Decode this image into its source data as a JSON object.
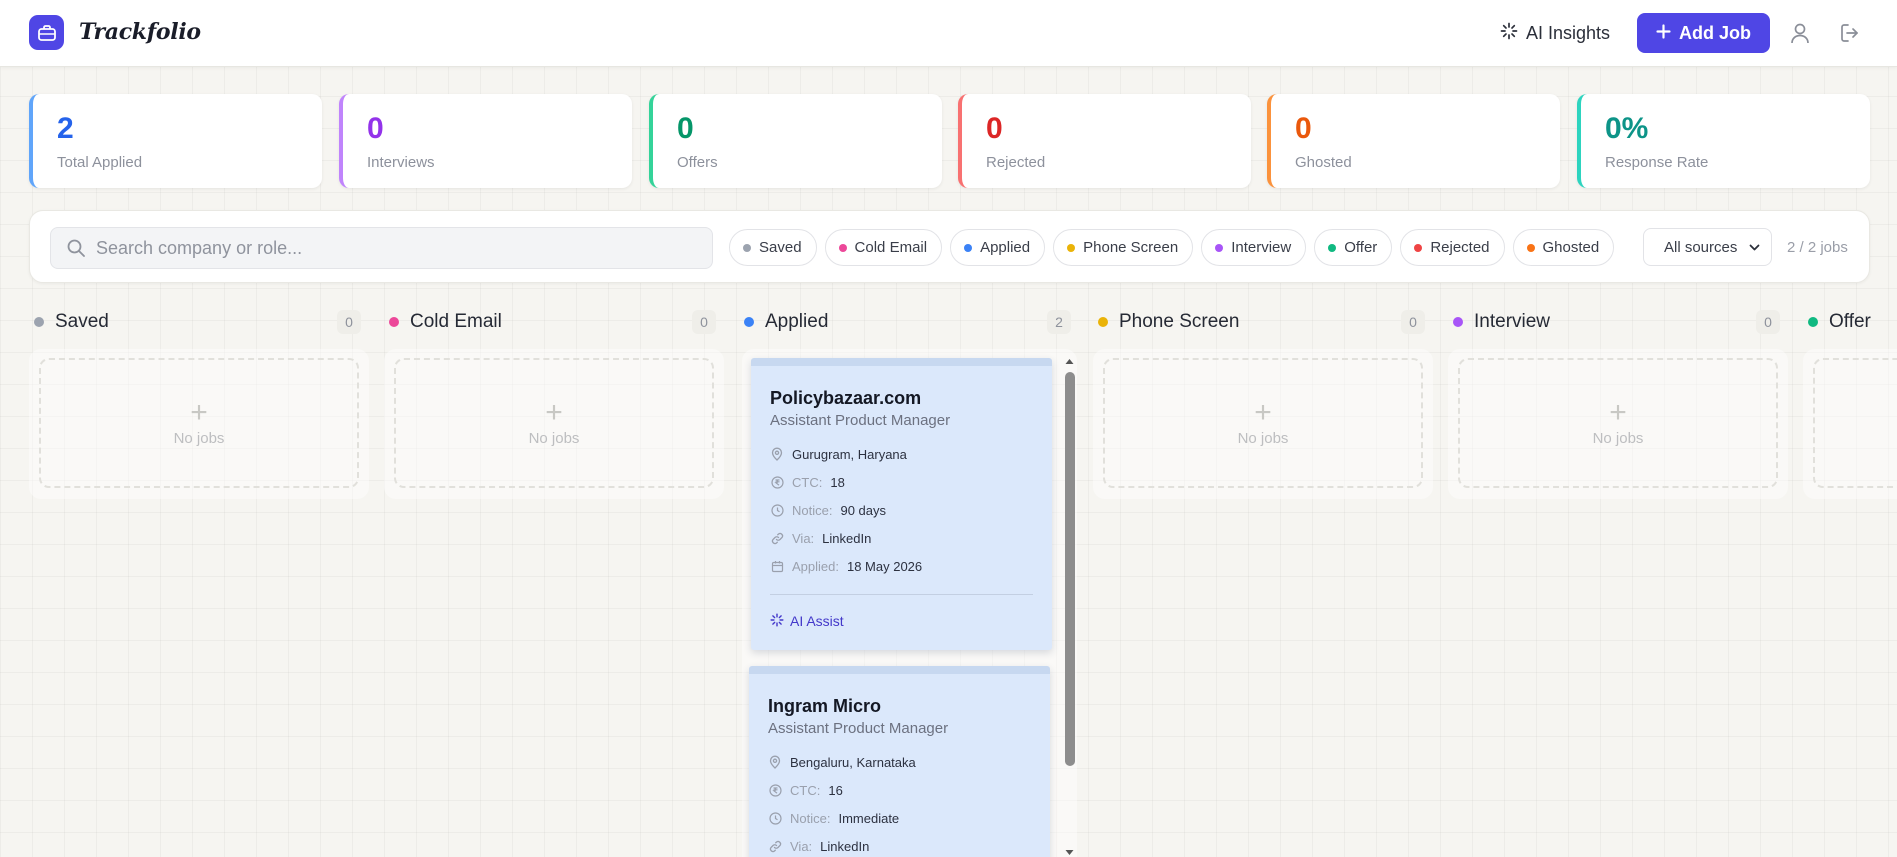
{
  "app": {
    "brand": "Trackfolio",
    "ai_insights_label": "AI Insights",
    "add_job_label": "Add Job",
    "accent": "#4f46e5"
  },
  "stats": [
    {
      "value": "2",
      "label": "Total Applied",
      "color": "#2563eb",
      "border": "#60a5fa"
    },
    {
      "value": "0",
      "label": "Interviews",
      "color": "#9333ea",
      "border": "#c084fc"
    },
    {
      "value": "0",
      "label": "Offers",
      "color": "#059669",
      "border": "#34d399"
    },
    {
      "value": "0",
      "label": "Rejected",
      "color": "#dc2626",
      "border": "#f87171"
    },
    {
      "value": "0",
      "label": "Ghosted",
      "color": "#ea580c",
      "border": "#fb923c"
    },
    {
      "value": "0%",
      "label": "Response Rate",
      "color": "#0d9488",
      "border": "#2dd4bf"
    }
  ],
  "filters": {
    "search_placeholder": "Search company or role...",
    "chips": [
      {
        "label": "Saved",
        "color": "#9ca3af"
      },
      {
        "label": "Cold Email",
        "color": "#ec4899"
      },
      {
        "label": "Applied",
        "color": "#3b82f6"
      },
      {
        "label": "Phone Screen",
        "color": "#eab308"
      },
      {
        "label": "Interview",
        "color": "#a855f7"
      },
      {
        "label": "Offer",
        "color": "#10b981"
      },
      {
        "label": "Rejected",
        "color": "#ef4444"
      },
      {
        "label": "Ghosted",
        "color": "#f97316"
      }
    ],
    "source_selected": "All sources",
    "job_count": "2 / 2 jobs"
  },
  "columns": [
    {
      "title": "Saved",
      "count": "0",
      "color": "#9ca3af",
      "empty_text": "No jobs",
      "plus": "+"
    },
    {
      "title": "Cold Email",
      "count": "0",
      "color": "#ec4899",
      "empty_text": "No jobs",
      "plus": "+"
    },
    {
      "title": "Applied",
      "count": "2",
      "color": "#3b82f6"
    },
    {
      "title": "Phone Screen",
      "count": "0",
      "color": "#eab308",
      "empty_text": "No jobs",
      "plus": "+"
    },
    {
      "title": "Interview",
      "count": "0",
      "color": "#a855f7",
      "empty_text": "No jobs",
      "plus": "+"
    },
    {
      "title": "Offer",
      "color": "#10b981"
    }
  ],
  "cards": [
    {
      "company": "Policybazaar.com",
      "role": "Assistant Product Manager",
      "location": "Gurugram, Haryana",
      "ctc_label": "CTC:",
      "ctc": "18",
      "notice_label": "Notice:",
      "notice": "90 days",
      "via_label": "Via:",
      "via": "LinkedIn",
      "applied_label": "Applied:",
      "applied": "18 May 2026",
      "ai_assist": "AI Assist"
    },
    {
      "company": "Ingram Micro",
      "role": "Assistant Product Manager",
      "location": "Bengaluru, Karnataka",
      "ctc_label": "CTC:",
      "ctc": "16",
      "notice_label": "Notice:",
      "notice": "Immediate",
      "via_label": "Via:",
      "via": "LinkedIn"
    }
  ]
}
